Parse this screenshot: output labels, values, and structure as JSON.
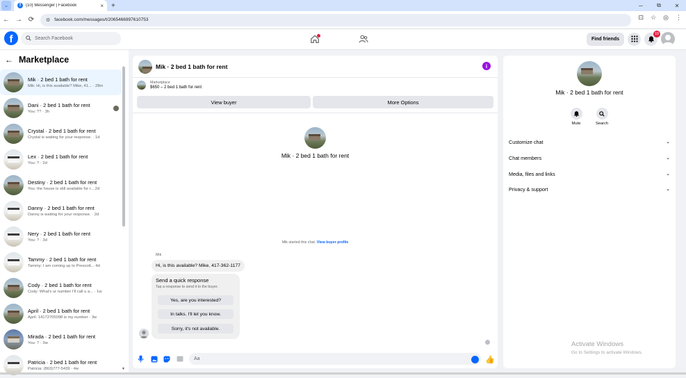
{
  "browser": {
    "tab_title": "(10) Messenger | Facebook",
    "tab_close": "×",
    "new_tab": "+",
    "url": "facebook.com/messages/t/2065466997610753",
    "window_controls": [
      "─",
      "⧉",
      "✕"
    ]
  },
  "facebook": {
    "search_placeholder": "Search Facebook",
    "find_friends": "Find friends",
    "notification_count": "10"
  },
  "sidebar": {
    "title": "Marketplace",
    "conversations": [
      {
        "name": "Mik · 2 bed 1 bath for rent",
        "preview": "Mik: Hi, is this available? Mike, 41... · 28m",
        "active": true
      },
      {
        "name": "Dani · 2 bed 1 bath for rent",
        "preview": "You: ?? · 3h"
      },
      {
        "name": "Crystal · 2 bed 1 bath for rent",
        "preview": "Crystal is waiting for your response. · 1d"
      },
      {
        "name": "Lex · 2 bed 1 bath for rent",
        "preview": "You: ? · 2d"
      },
      {
        "name": "Destiny · 2 bed 1 bath for rent",
        "preview": "You: the house is still available for r...  2d"
      },
      {
        "name": "Danny · 2 bed 1 bath for rent",
        "preview": "Danny is waiting for your response. · 2d"
      },
      {
        "name": "Nery · 2 bed 1 bath for rent",
        "preview": "You: ? · 3d"
      },
      {
        "name": "Tammy · 2 bed 1 bath for rent",
        "preview": "Tammy: I am coming up to Prescott...  4d"
      },
      {
        "name": "Cody · 2 bed 1 bath for rent",
        "preview": "Cody: What's ur number I'll call u a... · 1w"
      },
      {
        "name": "April · 2 bed 1 bath for rent",
        "preview": "April: 14172705098 is my number · 3w"
      },
      {
        "name": "Mirada · 2 bed 1 bath for rent",
        "preview": "You: ? · 3w"
      },
      {
        "name": "Patricia · 2 bed 1 bath for rent",
        "preview": "Patricia: (863)777-5439 · 4w"
      }
    ]
  },
  "chat": {
    "title": "Mik · 2 bed 1 bath for rent",
    "marketplace_label": "Marketplace",
    "listing": "$650 – 2 bed 1 bath for rent",
    "view_buyer": "View buyer",
    "more_options": "More Options",
    "center_name": "Mik · 2 bed 1 bath for rent",
    "started_text": "Mik started this chat.",
    "view_buyer_profile": "View buyer profile",
    "sender": "Mik",
    "message": "Hi, is this available? Mike, 417-362-1177",
    "quick_title": "Send a quick response",
    "quick_sub": "Tap a response to send it to the buyer.",
    "quick_responses": [
      "Yes, are you interested?",
      "In talks. I'll let you know.",
      "Sorry, it's not available."
    ],
    "input_placeholder": "Aa"
  },
  "details": {
    "name": "Mik · 2 bed 1 bath for rent",
    "mute": "Mute",
    "search": "Search",
    "sections": [
      "Customize chat",
      "Chat members",
      "Media, files and links",
      "Privacy & support"
    ]
  },
  "watermark": {
    "line1": "Activate Windows",
    "line2": "Go to Settings to activate Windows."
  },
  "colors": {
    "accent": "#0866ff",
    "info": "#9b12e0",
    "notification": "#e41e3f"
  }
}
